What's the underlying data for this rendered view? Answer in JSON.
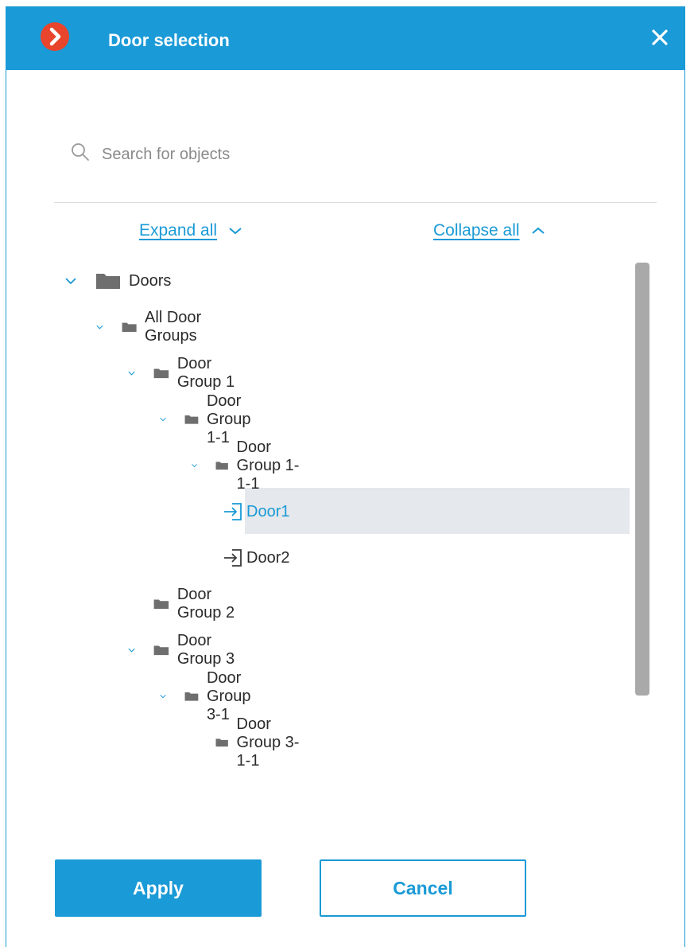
{
  "window": {
    "title": "Door selection"
  },
  "colors": {
    "accent": "#1a9ad6",
    "logo": "#e8452c",
    "selected_bg": "#e5e8ec"
  },
  "icons": {
    "logo": "chevron-right-logo-icon",
    "close": "close-icon",
    "search": "search-icon",
    "folder": "folder-icon",
    "door": "door-enter-icon",
    "chevron": "chevron-down-icon"
  },
  "search": {
    "placeholder": "Search for objects",
    "value": ""
  },
  "toolbar": {
    "expand_all": "Expand all",
    "collapse_all": "Collapse all"
  },
  "tree": [
    {
      "label": "Doors",
      "level": 0,
      "type": "folder",
      "expanded": true
    },
    {
      "label": "All Door Groups",
      "level": 1,
      "type": "folder",
      "expanded": true
    },
    {
      "label": "Door Group 1",
      "level": 2,
      "type": "folder",
      "expanded": true
    },
    {
      "label": "Door Group 1-1",
      "level": 3,
      "type": "folder",
      "expanded": true
    },
    {
      "label": "Door Group 1-1-1",
      "level": 4,
      "type": "folder",
      "expanded": true
    },
    {
      "label": "Door1",
      "level": 5,
      "type": "door",
      "selected": true
    },
    {
      "label": "Door2",
      "level": 5,
      "type": "door"
    },
    {
      "label": "Door Group 2",
      "level": 2,
      "type": "folder",
      "expanded": false,
      "leaf": true
    },
    {
      "label": "Door Group 3",
      "level": 2,
      "type": "folder",
      "expanded": true
    },
    {
      "label": "Door Group 3-1",
      "level": 3,
      "type": "folder",
      "expanded": true
    },
    {
      "label": "Door Group 3-1-1",
      "level": 4,
      "type": "folder",
      "expanded": false,
      "leaf": true
    }
  ],
  "buttons": {
    "apply": "Apply",
    "cancel": "Cancel"
  }
}
